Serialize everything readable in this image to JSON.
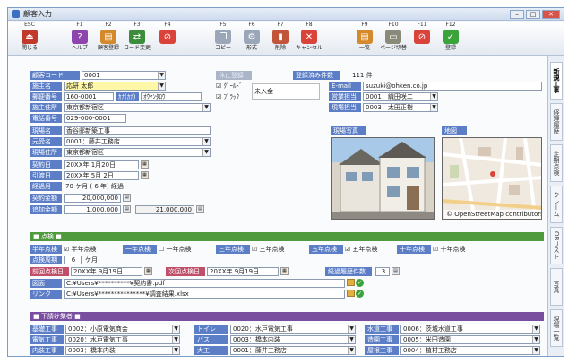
{
  "window": {
    "title": "顧客入力",
    "min": "–",
    "max": "□",
    "close": "✕"
  },
  "toolbar": [
    {
      "key": "ESC",
      "label": "閉じる",
      "icon": "close-door-icon",
      "color": "#c0392b",
      "glyph": "⏏"
    },
    {
      "key": "F1",
      "label": "ヘルプ",
      "icon": "help-icon",
      "color": "#8e44ad",
      "glyph": "?"
    },
    {
      "key": "F2",
      "label": "顧客登録",
      "icon": "register-customer-icon",
      "color": "#d4892a",
      "glyph": "▤"
    },
    {
      "key": "F3",
      "label": "コード変更",
      "icon": "code-change-icon",
      "color": "#3b8d3b",
      "glyph": "⇄"
    },
    {
      "key": "F4",
      "label": "",
      "icon": "prohibited-icon",
      "color": "#d9433a",
      "glyph": "⊘"
    },
    {
      "key": "F5",
      "label": "コピー",
      "icon": "copy-icon",
      "color": "#9aa7b8",
      "glyph": "❐"
    },
    {
      "key": "F6",
      "label": "形式",
      "icon": "format-icon",
      "color": "#9aa7b8",
      "glyph": "⚙"
    },
    {
      "key": "F7",
      "label": "削除",
      "icon": "delete-icon",
      "color": "#c2543a",
      "glyph": "▮"
    },
    {
      "key": "F8",
      "label": "キャンセル",
      "icon": "cancel-icon",
      "color": "#d9433a",
      "glyph": "✕"
    },
    {
      "key": "F9",
      "label": "一覧",
      "icon": "list-icon",
      "color": "#d4892a",
      "glyph": "▤"
    },
    {
      "key": "F10",
      "label": "ページ切替",
      "icon": "page-switch-icon",
      "color": "#8a8a7a",
      "glyph": "▭"
    },
    {
      "key": "F11",
      "label": "",
      "icon": "prohibited-icon",
      "color": "#d9433a",
      "glyph": "⊘"
    },
    {
      "key": "F12",
      "label": "登録",
      "icon": "register-check-icon",
      "color": "#3aa33a",
      "glyph": "✓"
    }
  ],
  "sidetabs": [
    "新規工事",
    "経理履歴",
    "定期点検",
    "クレーム",
    "OBリスト",
    "写真",
    "現場一覧"
  ],
  "customer": {
    "code_label": "顧客コード",
    "code": "0001",
    "name_label": "施主名",
    "name": "応研 太郎",
    "postal_label": "郵便番号",
    "postal": "160-0001",
    "kana_label": "ｶﾅ(ｶﾅ)",
    "kana": "ｵｳｹﾝﾀﾛｳ",
    "address_label": "施主住所",
    "address": "東京都新宿区",
    "phone_label": "電話番号",
    "phone": "029-000-0001",
    "site_label": "現場名",
    "site": "香谷邸新築工事",
    "contractor_label": "元受名",
    "contractor": "0001：藤井工務店",
    "site_address_label": "現場住所",
    "site_address": "東京都新宿区",
    "contract_label": "契約日",
    "contract_date": "20XX年 1月20日",
    "handover_label": "引渡日",
    "handover_date": "20XX年 5月 2日",
    "elapsed_label": "経過月",
    "elapsed": "70 ケ月 ( 6 年) 経過",
    "contract_amount_label": "契約金額",
    "contract_amount": "20,000,000",
    "additional_label": "追加金額",
    "additional": "1,000,000",
    "total": "21,000,000"
  },
  "status": {
    "disabled_btn": "休止登録",
    "deal_count_label": "登録済み件数",
    "deal_count": "111 件",
    "good_label": "ｸﾞｰﾙﾄﾞ",
    "black_label": "ﾌﾞﾗｯｸ",
    "unpaid": "未入金",
    "email_label": "E-mail",
    "email": "suzuki@ohken.co.jp",
    "sales_label": "営業担当",
    "sales": "0001：織田咲二",
    "site_manager_label": "現場担当",
    "site_manager": "0003：太田正樹"
  },
  "photo": {
    "site_label": "現場写真",
    "map_label": "地図",
    "map_credit": "© OpenStreetMap contributors"
  },
  "inspection": {
    "section": "■ 点検 ■",
    "half_label": "半年点検",
    "half": "半年点検",
    "one_label": "一年点検",
    "one": "一年点検",
    "three_label": "三年点検",
    "three": "三年点検",
    "five_label": "五年点検",
    "five": "五年点検",
    "ten_label": "十年点検",
    "ten": "十年点検",
    "cycle_label": "点検周期",
    "cycle": "6",
    "cycle_unit": "ケ月",
    "last_label": "前回点検日",
    "last_date": "20XX年 9月19日",
    "next_label": "次回点検日",
    "next_date": "20XX年 9月19日",
    "history_label": "経過履歴件数",
    "history": "3",
    "plan_label": "図面",
    "plan": "C:¥Users¥**********¥契約書.pdf",
    "link_label": "リンク",
    "link": "C:¥Users¥***************¥調査結果.xlsx"
  },
  "subcontractors": {
    "section": "■ 下請け業者 ■",
    "rows": [
      [
        {
          "label": "基礎工事",
          "value": "0002：小原電気商会"
        },
        {
          "label": "トイレ",
          "value": "0020：水戸電気工事"
        },
        {
          "label": "水道工事",
          "value": "0006：茨城水道工事"
        }
      ],
      [
        {
          "label": "電気工事",
          "value": "0020：水戸電気工事"
        },
        {
          "label": "バス",
          "value": "0003：橋本内装"
        },
        {
          "label": "造園工事",
          "value": "0005：米田造園"
        }
      ],
      [
        {
          "label": "内装工事",
          "value": "0003：橋本内装"
        },
        {
          "label": "大工",
          "value": "0001：藤井工務店"
        },
        {
          "label": "屋根工事",
          "value": "0004：植村工務店"
        }
      ]
    ]
  },
  "colors": {
    "label_bg": "#5b7ec6",
    "inspection_bar": "#4e9a3c",
    "subcontractor_bar": "#7a4e9e"
  }
}
